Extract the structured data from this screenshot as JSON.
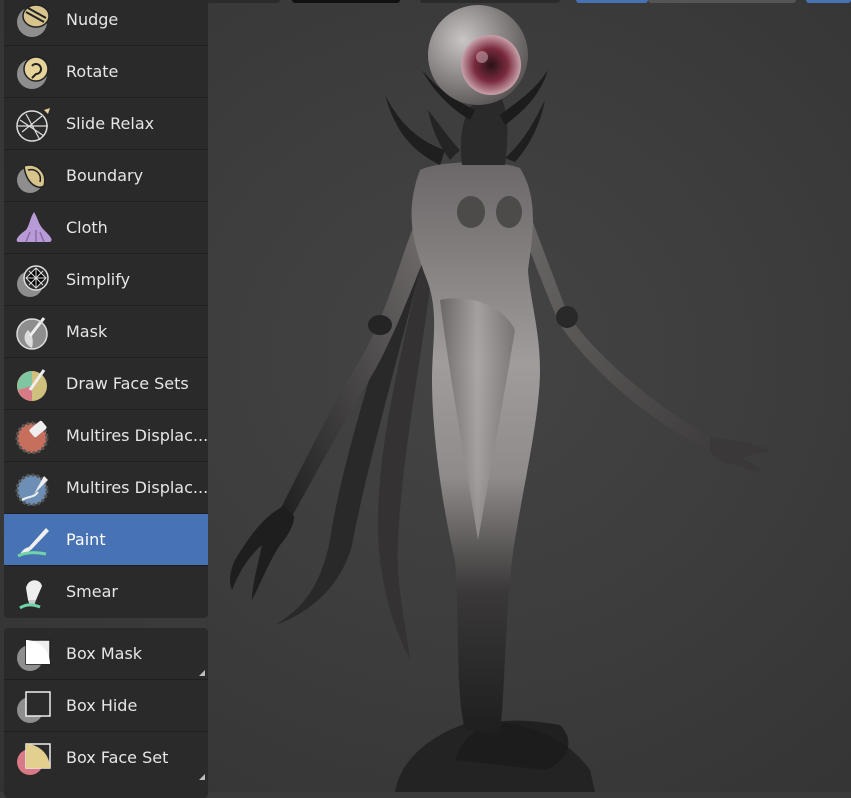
{
  "tools": [
    {
      "id": "nudge",
      "label": "Nudge",
      "icon": "nudge-icon"
    },
    {
      "id": "rotate",
      "label": "Rotate",
      "icon": "rotate-icon"
    },
    {
      "id": "slide-relax",
      "label": "Slide Relax",
      "icon": "slide-relax-icon"
    },
    {
      "id": "boundary",
      "label": "Boundary",
      "icon": "boundary-icon"
    },
    {
      "id": "cloth",
      "label": "Cloth",
      "icon": "cloth-icon"
    },
    {
      "id": "simplify",
      "label": "Simplify",
      "icon": "simplify-icon"
    },
    {
      "id": "mask",
      "label": "Mask",
      "icon": "mask-icon"
    },
    {
      "id": "draw-face-sets",
      "label": "Draw Face Sets",
      "icon": "draw-face-sets-icon"
    },
    {
      "id": "multires-displacement-eraser",
      "label": "Multires Displac...",
      "icon": "multires-displacement-eraser-icon"
    },
    {
      "id": "multires-displacement-smear",
      "label": "Multires Displac...",
      "icon": "multires-displacement-smear-icon"
    },
    {
      "id": "paint",
      "label": "Paint",
      "icon": "paint-icon",
      "active": true
    },
    {
      "id": "smear",
      "label": "Smear",
      "icon": "smear-icon"
    }
  ],
  "gesture_tools": [
    {
      "id": "box-mask",
      "label": "Box Mask",
      "icon": "box-mask-icon",
      "has_submenu": true
    },
    {
      "id": "box-hide",
      "label": "Box Hide",
      "icon": "box-hide-icon"
    },
    {
      "id": "box-face-set",
      "label": "Box Face Set",
      "icon": "box-face-set-icon",
      "has_submenu": true
    }
  ],
  "colors": {
    "active": "#4772b3",
    "panel": "#2a2a2a",
    "viewport": "#3b3b3b",
    "text": "#e6e6e6"
  }
}
